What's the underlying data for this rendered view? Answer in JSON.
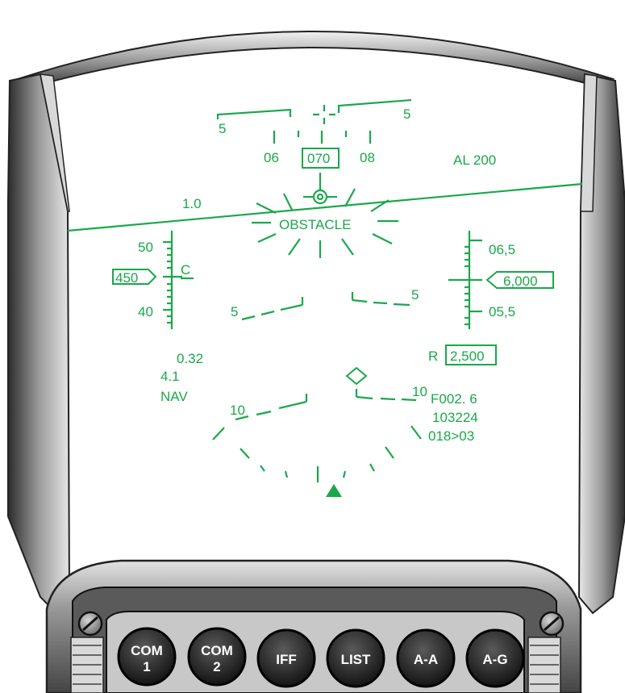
{
  "hud": {
    "color": "#1aa84a",
    "pitch_labels": {
      "top_left": "5",
      "top_right": "5"
    },
    "heading_scale": {
      "left": "06",
      "current": "070",
      "right": "08"
    },
    "altitude_low": "AL  200",
    "bank_scale_label": "1.0",
    "warning": "OBSTACLE",
    "speed_tape": {
      "upper": "50",
      "current": "450",
      "lower": "40",
      "command_marker": "C"
    },
    "altitude_tape": {
      "upper": "06,5",
      "current": "6,000",
      "lower": "05,5"
    },
    "pitch_ladder": {
      "minus5_left": "5",
      "minus5_right": "5",
      "minus10_left": "10",
      "minus10_right": "10"
    },
    "flight_data": {
      "mach": "0.32",
      "g_load": "4.1",
      "mode": "NAV"
    },
    "range": {
      "prefix": "R",
      "value": "2,500"
    },
    "waypoint": {
      "line1": "F002. 6",
      "line2": "103224",
      "line3": "018>03"
    }
  },
  "bezel_buttons": [
    {
      "line1": "COM",
      "line2": "1"
    },
    {
      "line1": "COM",
      "line2": "2"
    },
    {
      "line1": "IFF",
      "line2": ""
    },
    {
      "line1": "LIST",
      "line2": ""
    },
    {
      "line1": "A-A",
      "line2": ""
    },
    {
      "line1": "A-G",
      "line2": ""
    }
  ]
}
